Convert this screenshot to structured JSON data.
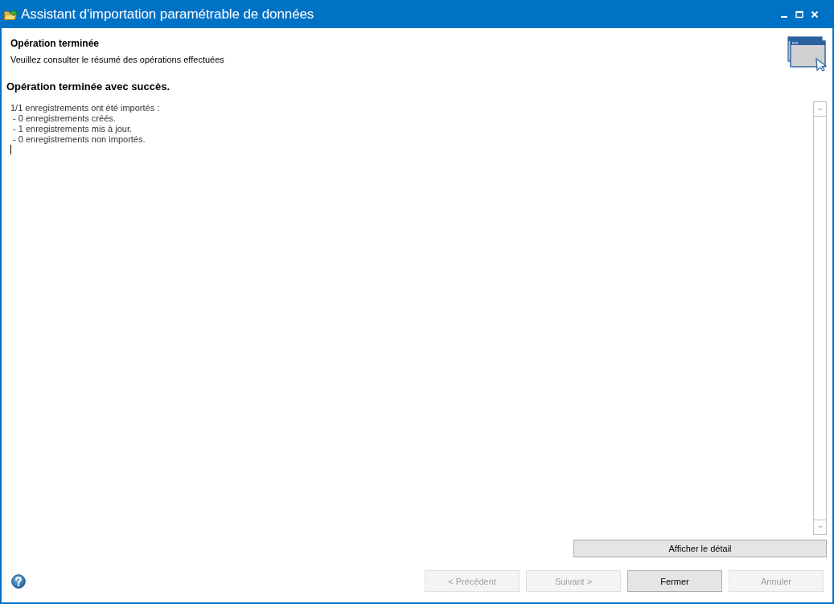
{
  "window": {
    "title": "Assistant d'importation paramétrable de données"
  },
  "header": {
    "title": "Opération terminée",
    "subtitle": "Veuillez consulter le résumé des opérations effectuées"
  },
  "status_message": "Opération terminée avec succès.",
  "summary": {
    "lines": [
      "1/1 enregistrements ont été importés :",
      " - 0 enregistrements créés.",
      " - 1 enregistrements mis à jour.",
      " - 0 enregistrements non importés."
    ]
  },
  "detail_button": {
    "label": "Afficher le détail"
  },
  "buttons": [
    {
      "label": "< Précédent",
      "disabled": true
    },
    {
      "label": "Suivant >",
      "disabled": true
    },
    {
      "label": "Fermer",
      "disabled": false
    },
    {
      "label": "Annuler",
      "disabled": true
    }
  ]
}
